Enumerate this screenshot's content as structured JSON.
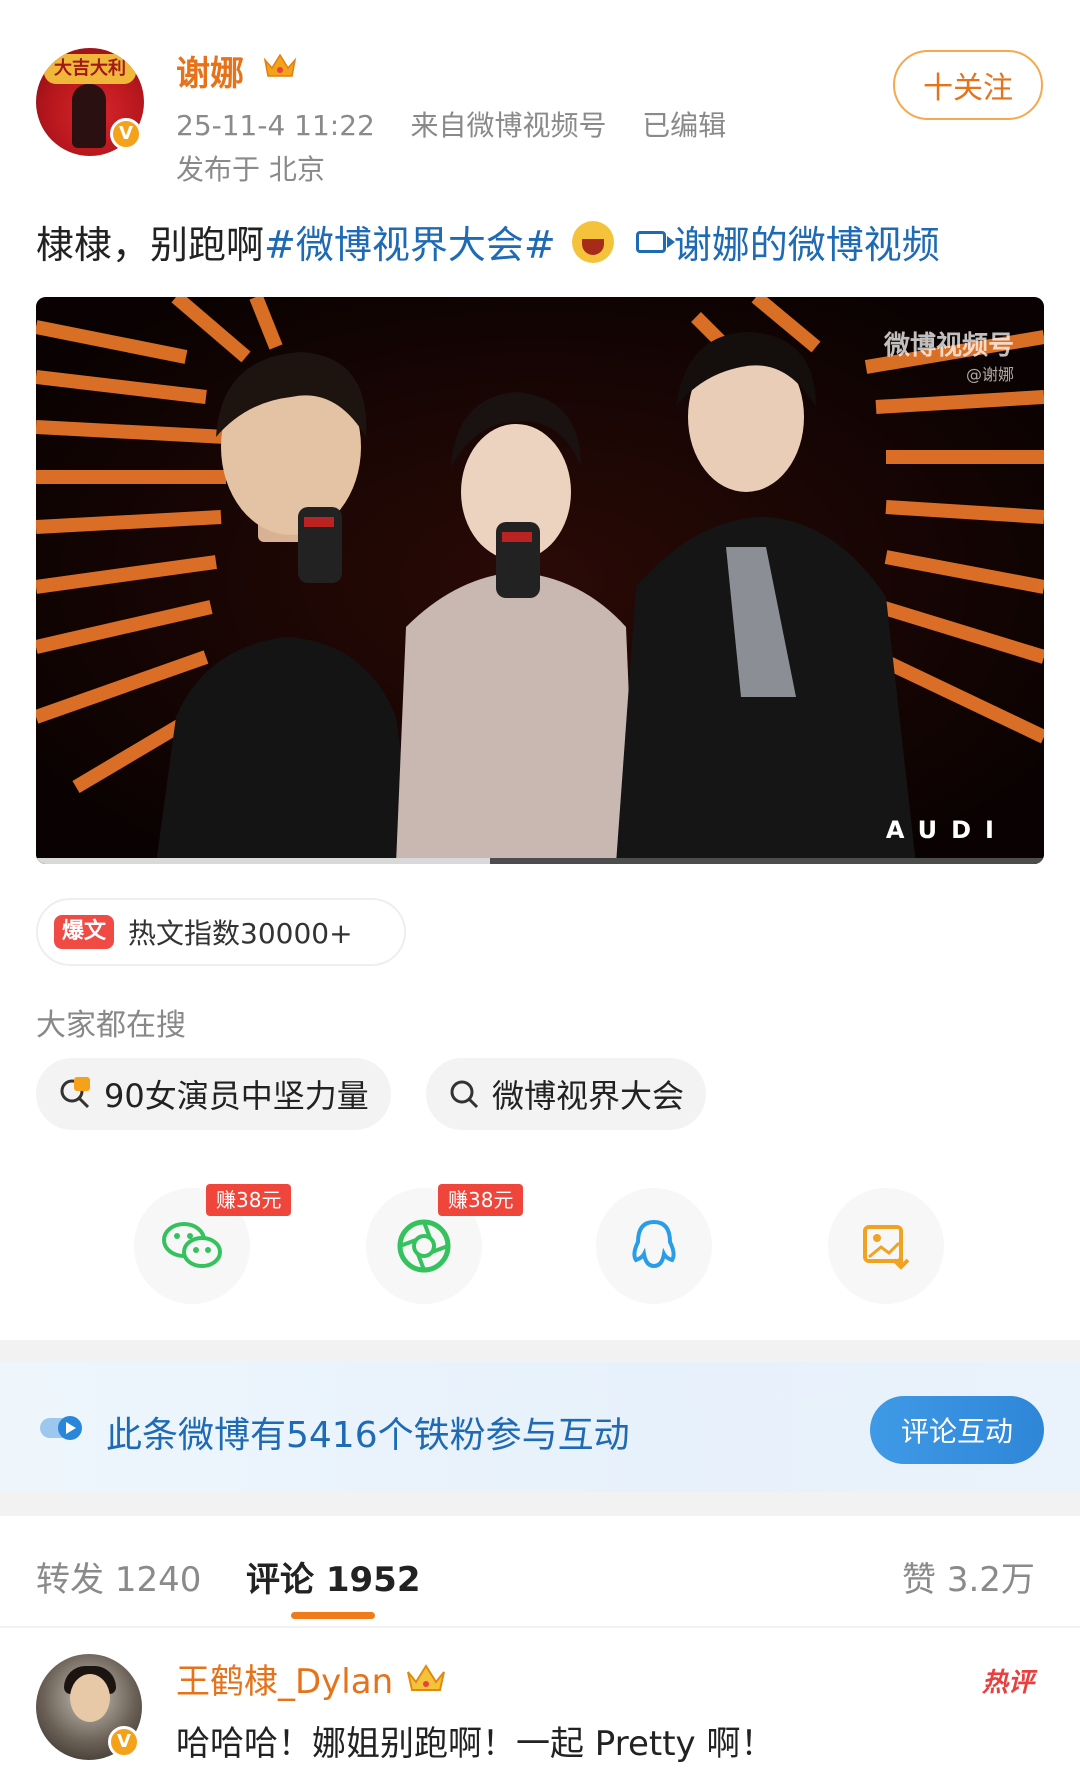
{
  "post": {
    "author": "谢娜",
    "timestamp": "25-11-4 11:22",
    "source": "来自微博视频号",
    "edited": "已编辑",
    "location": "发布于 北京",
    "follow_label": "十关注",
    "text_main": "棣棣，别跑啊",
    "hashtag": "#微博视界大会#",
    "video_link": "谢娜的微博视频",
    "avatar_banner": "大吉大利",
    "verified": "V"
  },
  "video": {
    "watermark": "微博视频号",
    "watermark_sub": "@谢娜",
    "brand": "AUDI",
    "progress": 0.45
  },
  "hot": {
    "badge": "爆文",
    "text": "热文指数30000+"
  },
  "search": {
    "title": "大家都在搜",
    "chips": [
      "90女演员中坚力量",
      "微博视界大会"
    ]
  },
  "share": {
    "earn_label": "赚38元",
    "icons": [
      "wechat-icon",
      "moments-icon",
      "qq-icon",
      "save-image-icon"
    ]
  },
  "banner": {
    "text": "此条微博有5416个铁粉参与互动",
    "button": "评论互动"
  },
  "tabs": {
    "repost_label": "转发",
    "repost_count": "1240",
    "comment_label": "评论",
    "comment_count": "1952",
    "like_label": "赞",
    "like_count": "3.2万"
  },
  "comment": {
    "name": "王鹤棣_Dylan",
    "hot_tag": "热评",
    "text": "哈哈哈！娜姐别跑啊！一起 Pretty 啊！",
    "verified": "V"
  },
  "colors": {
    "accent_orange": "#e6721a",
    "link_blue": "#1e6ab4",
    "earn_red": "#f0453a"
  }
}
